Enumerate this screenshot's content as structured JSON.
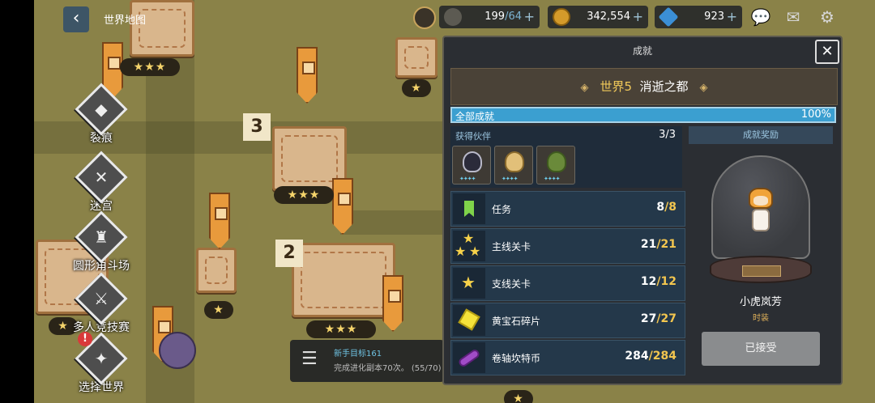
{
  "nav": {
    "back_icon": "back-arrow-icon",
    "world_map_label": "世界地图"
  },
  "map": {
    "stage_numbers": [
      "3",
      "2"
    ],
    "star_bars": [
      "★★★",
      "★",
      "★★★",
      "★",
      "★★★",
      "★",
      "★"
    ]
  },
  "sidebar": {
    "items": [
      {
        "label": "裂痕",
        "icon": "rift-icon"
      },
      {
        "label": "迷宫",
        "icon": "labyrinth-icon"
      },
      {
        "label": "圆形角斗场",
        "icon": "colosseum-icon"
      },
      {
        "label": "多人竞技赛",
        "icon": "arena-icon"
      },
      {
        "label": "选择世界",
        "icon": "world-select-icon"
      }
    ]
  },
  "topbar": {
    "stamina": {
      "value": "199",
      "max": "/64",
      "icon": "coffee-icon"
    },
    "gold": {
      "value": "342,554",
      "icon": "gold-coin-icon"
    },
    "gems": {
      "value": "923",
      "icon": "gem-icon"
    }
  },
  "quest": {
    "title": "新手目标161",
    "desc": "完成进化副本70次。 (55/70)"
  },
  "modal": {
    "title": "成就",
    "world_number": "世界5",
    "world_name": "消逝之都",
    "overall_label": "全部成就",
    "overall_percent": "100%",
    "overall_fraction": 1.0,
    "companions_label": "获得伙伴",
    "companions_count": "3/3",
    "rows": [
      {
        "name": "任务",
        "current": "8",
        "total": "/8",
        "icon": "bookmark-icon"
      },
      {
        "name": "主线关卡",
        "current": "21",
        "total": "/21",
        "icon": "three-stars-icon"
      },
      {
        "name": "支线关卡",
        "current": "12",
        "total": "/12",
        "icon": "star-icon"
      },
      {
        "name": "黄宝石碎片",
        "current": "27",
        "total": "/27",
        "icon": "topaz-icon"
      },
      {
        "name": "卷轴坎特币",
        "current": "284",
        "total": "/284",
        "icon": "scroll-icon"
      }
    ],
    "reward_header": "成就奖励",
    "reward_name": "小虎岚芳",
    "reward_type": "时装",
    "claimed_label": "已接受"
  },
  "colors": {
    "accent": "#3b9fd0",
    "gold_text": "#f3c64f",
    "panel": "#2b2e33"
  }
}
